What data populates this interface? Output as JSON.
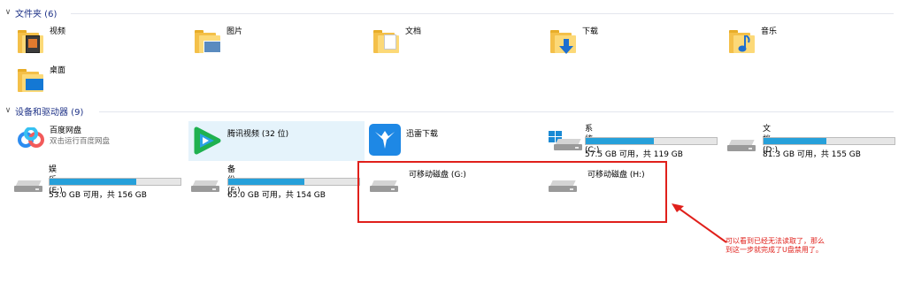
{
  "folders_group": {
    "header": "文件夹 (6)",
    "items": [
      {
        "label": "视频",
        "icon": "video-folder-icon"
      },
      {
        "label": "图片",
        "icon": "pictures-folder-icon"
      },
      {
        "label": "文档",
        "icon": "documents-folder-icon"
      },
      {
        "label": "下载",
        "icon": "downloads-folder-icon"
      },
      {
        "label": "音乐",
        "icon": "music-folder-icon"
      },
      {
        "label": "桌面",
        "icon": "desktop-folder-icon"
      }
    ]
  },
  "devices_group": {
    "header": "设备和驱动器 (9)",
    "apps": [
      {
        "label": "百度网盘",
        "sub": "双击运行百度网盘",
        "icon": "baidu-netdisk-icon"
      },
      {
        "label": "腾讯视频 (32 位)",
        "icon": "tencent-video-icon"
      },
      {
        "label": "迅雷下载",
        "icon": "xunlei-icon"
      }
    ],
    "drives": [
      {
        "label": "系统 (C:)",
        "free": "57.5 GB 可用，共 119 GB",
        "used_fraction": 0.52,
        "icon": "windows-drive-icon"
      },
      {
        "label": "文档 (D:)",
        "free": "81.3 GB 可用，共 155 GB",
        "used_fraction": 0.48,
        "icon": "hard-drive-icon"
      },
      {
        "label": "娱乐 (E:)",
        "free": "53.0 GB 可用，共 156 GB",
        "used_fraction": 0.66,
        "icon": "hard-drive-icon"
      },
      {
        "label": "备份 (F:)",
        "free": "65.0 GB 可用，共 154 GB",
        "used_fraction": 0.58,
        "icon": "hard-drive-icon"
      }
    ],
    "removable": [
      {
        "label": "可移动磁盘 (G:)",
        "icon": "removable-drive-icon"
      },
      {
        "label": "可移动磁盘 (H:)",
        "icon": "removable-drive-icon"
      }
    ]
  },
  "annotation": {
    "line1": "可以看到已经无法读取了，那么",
    "line2": "到这一步就完成了U盘禁用了。",
    "color": "#e0201b"
  },
  "colors": {
    "header_text": "#1e3287",
    "bar_fill": "#26a0da",
    "selection": "#e5f3fb"
  }
}
